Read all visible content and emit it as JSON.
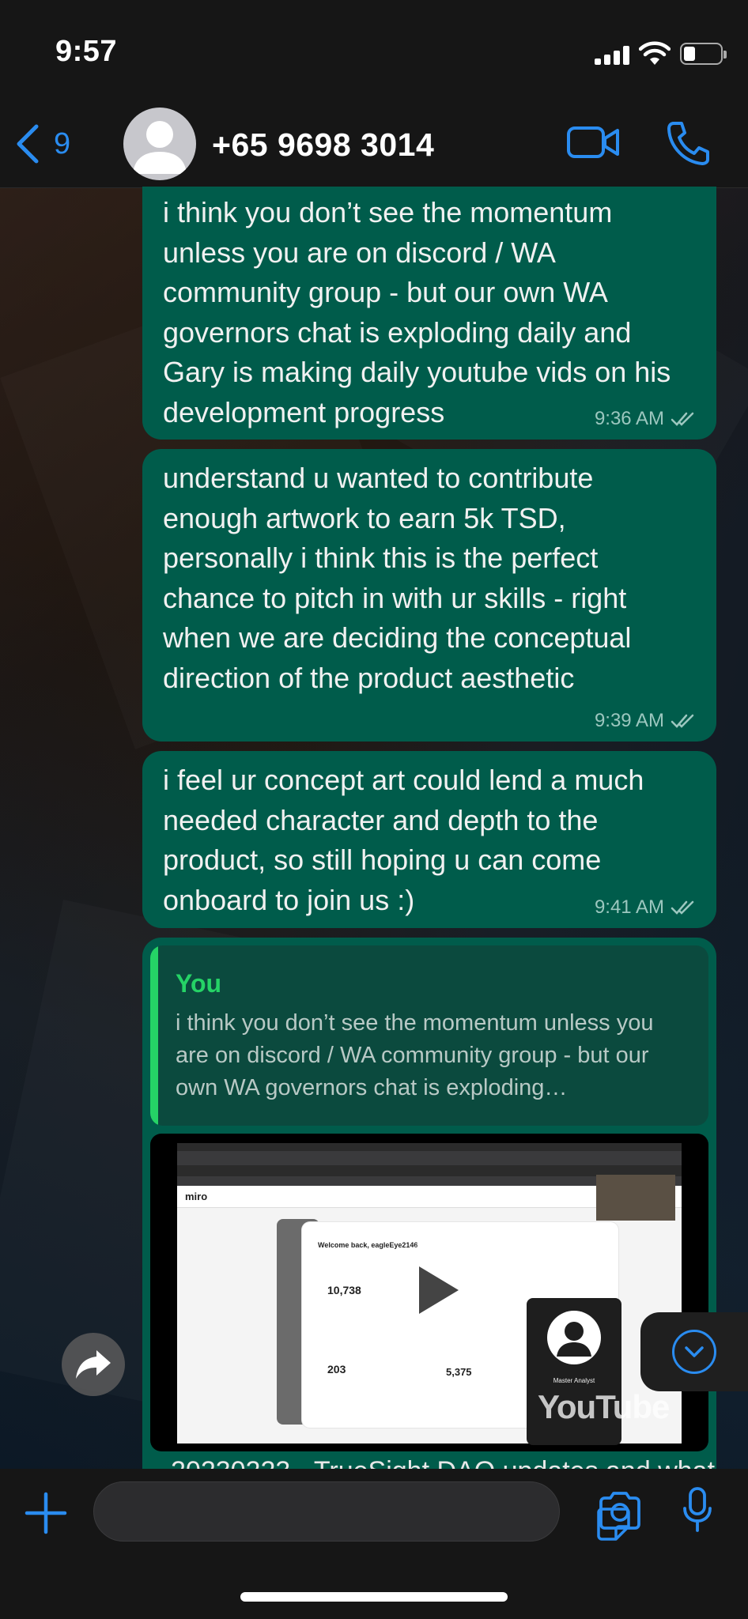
{
  "status_bar": {
    "time": "9:57"
  },
  "header": {
    "back_count": "9",
    "contact": "+65 9698 3014"
  },
  "messages": [
    {
      "text": "i think you don’t see the momentum unless you are on discord / WA community group - but our own WA governors chat is exploding daily and Gary is making daily youtube vids on his development progress",
      "time": "9:36 AM"
    },
    {
      "text": "understand u wanted to contribute enough artwork to earn 5k TSD, personally i think this is the perfect chance to pitch in with ur skills - right when we are deciding the conceptual direction of the product aesthetic",
      "time": "9:39 AM"
    },
    {
      "text": "i feel ur concept art could lend a much needed character and depth to the product, so still hoping u can come onboard to join us :)",
      "time": "9:41 AM"
    }
  ],
  "reply": {
    "author": "You",
    "quote": "i think you don’t see the momentum unless you are on discord / WA community group - but our own WA governors chat is exploding…"
  },
  "video": {
    "app_logo": "miro",
    "welcome": "Welcome back, eagleEye2146",
    "balance": "10,738",
    "score": "203",
    "jackpot": "5,375",
    "profile": "Master Analyst",
    "youtube": "YouTube"
  },
  "next_caption": "20230223 · TrueSight DAO updates and what",
  "icons": {
    "back": "chevron-left-icon",
    "video_call": "video-camera-icon",
    "call": "phone-icon",
    "share": "share-forward-icon",
    "scroll_down": "chevron-down-circle-icon",
    "attach": "plus-icon",
    "sticker": "sticker-icon",
    "camera": "camera-icon",
    "mic": "microphone-icon"
  },
  "colors": {
    "accent": "#2a8cf0",
    "bubble": "#005c4b",
    "reply_author": "#25d366"
  }
}
